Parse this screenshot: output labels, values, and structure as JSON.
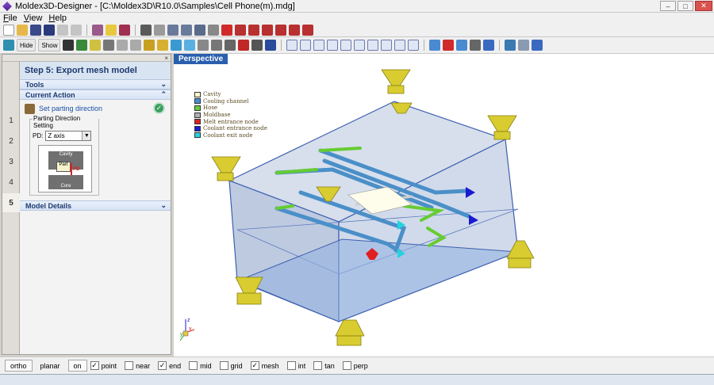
{
  "window": {
    "title": "Moldex3D-Designer - [C:\\Moldex3D\\R10.0\\Samples\\Cell Phone(m).mdg]"
  },
  "menu": [
    "File",
    "View",
    "Help"
  ],
  "toolbar2": {
    "hide_label": "Hide",
    "show_label": "Show"
  },
  "panel": {
    "step_title": "Step 5: Export mesh model",
    "steps": [
      "1",
      "2",
      "3",
      "4",
      "5"
    ],
    "sections": {
      "tools": "Tools",
      "current_action": "Current Action",
      "model_details": "Model Details"
    },
    "action": {
      "label": "Set parting direction"
    },
    "parting": {
      "legend": "Parting Direction Setting",
      "pd_label": "PD:",
      "pd_value": "Z axis",
      "diagram": {
        "cavity": "Cavity",
        "part": "Part",
        "core": "Core",
        "pd": "PD"
      }
    }
  },
  "viewport": {
    "tab": "Perspective",
    "legend": [
      {
        "label": "Cavity",
        "color": "#fefecc"
      },
      {
        "label": "Cooling channel",
        "color": "#3f8fd8"
      },
      {
        "label": "Hose",
        "color": "#66cc33"
      },
      {
        "label": "Moldbase",
        "color": "#b0b0b0"
      },
      {
        "label": "Melt entrance node",
        "color": "#e02020"
      },
      {
        "label": "Coolant entrance node",
        "color": "#1a1ad0"
      },
      {
        "label": "Coolant exit node",
        "color": "#22d4e0"
      }
    ],
    "axes": {
      "x": "x",
      "y": "y",
      "z": "z"
    }
  },
  "status": {
    "buttons": [
      "ortho",
      "planar",
      "on"
    ],
    "snaps": [
      {
        "label": "point",
        "checked": true
      },
      {
        "label": "near",
        "checked": false
      },
      {
        "label": "end",
        "checked": true
      },
      {
        "label": "mid",
        "checked": false
      },
      {
        "label": "grid",
        "checked": false
      },
      {
        "label": "mesh",
        "checked": true
      },
      {
        "label": "int",
        "checked": false
      },
      {
        "label": "tan",
        "checked": false
      },
      {
        "label": "perp",
        "checked": false
      }
    ]
  }
}
